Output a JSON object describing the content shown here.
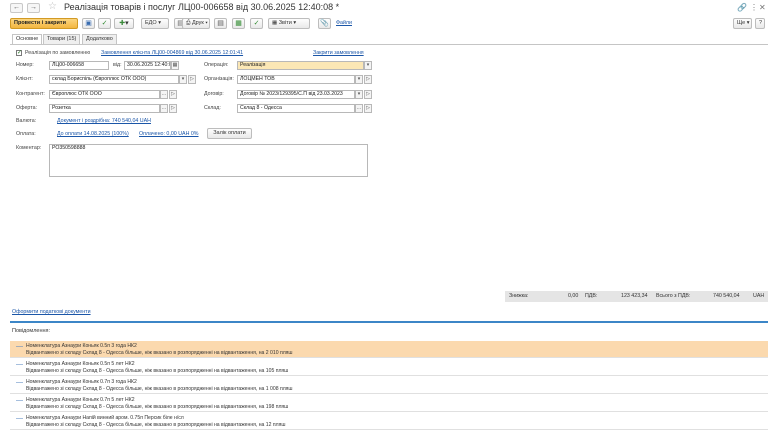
{
  "window": {
    "title": "Реалізація товарів і послуг ЛЦ00-006658 від 30.06.2025 12:40:08 *"
  },
  "toolbar": {
    "post_close": "Провести і закрити",
    "edo": "ЕДО",
    "print": "Друк",
    "reports": "Звіти",
    "files": "Файли",
    "more": "Ще",
    "help": "?"
  },
  "tabs": [
    {
      "label": "Основне",
      "active": true
    },
    {
      "label": "Товари (15)",
      "active": false
    },
    {
      "label": "Додатково",
      "active": false
    }
  ],
  "header": {
    "by_order_label": "Реалізація по замовленню",
    "order_link": "Замовлення клієнта ЛЦ00-004869 від 30.06.2025 12:01:41",
    "close_orders_link": "Закрити замовлення"
  },
  "form": {
    "number_label": "Номер:",
    "number_value": "ЛЦ00-006658",
    "date_label": "від:",
    "date_value": "30.06.2025 12:40:08",
    "operation_label": "Операція:",
    "operation_value": "Реалізація",
    "client_label": "Клієнт:",
    "client_value": "склад Бориспіль (Європлюс ОТК ООО)",
    "organization_label": "Організація:",
    "organization_value": "ЛОЦМЕН ТОВ",
    "counterparty_label": "Контрагент:",
    "counterparty_value": "Європлюс ОТК ООО",
    "contract_label": "Договір:",
    "contract_value": "Договір № 2023/129395/С.П від 23.03.2023",
    "offer_label": "Оферта:",
    "offer_value": "Розетка",
    "warehouse_label": "Склад:",
    "warehouse_value": "Склад 8 - Одесса",
    "currency_label": "Валюта:",
    "currency_link": "Документ і роздрібна:  740 540,04  UAH",
    "payment_label": "Оплата:",
    "payment_due_link": "До оплати 14.08.2025 (100%)",
    "paid_link": "Оплачено: 0,00 UAH 0%",
    "payment_button": "Залік оплати",
    "comment_label": "Коментар:",
    "comment_value": "РО350598888"
  },
  "totals": {
    "discount_label": "Знижка:",
    "discount_value": "0,00",
    "vat_label": "ПДВ:",
    "vat_value": "123 423,34",
    "total_label": "Всього з ПДВ:",
    "total_value": "740 540,04",
    "currency": "UAH"
  },
  "tax_link": "Оформити податкові документи",
  "messages_title": "Повідомлення:",
  "messages": [
    {
      "line1": "Номенклатура Азнаури Коньяк 0.5п 3 года НК2",
      "line2": "Відвантажено зі складу Склад 8 - Одесса більше, ніж вказано в розпорядженні на відвантаження, на 2 010 пляш",
      "highlight": true
    },
    {
      "line1": "Номенклатура Азнаури Коньяк 0.5п 5 лет НК2",
      "line2": "Відвантажено зі складу Склад 8 - Одесса більше, ніж вказано в розпорядженні на відвантаження, на 105 пляш",
      "highlight": false
    },
    {
      "line1": "Номенклатура Азнаури Коньяк 0.7п 3 года НК2",
      "line2": "Відвантажено зі складу Склад 8 - Одесса більше, ніж вказано в розпорядженні на відвантаження, на 1 008 пляш",
      "highlight": false
    },
    {
      "line1": "Номенклатура Азнаури Коньяк 0.7п 5 лет НК2",
      "line2": "Відвантажено зі складу Склад 8 - Одесса більше, ніж вказано в розпорядженні на відвантаження, на 198 пляш",
      "highlight": false
    },
    {
      "line1": "Номенклатура Азнаури Напій винний аром. 0.75п Персик біле н/сл",
      "line2": "Відвантажено зі складу Склад 8 - Одесса більше, ніж вказано в розпорядженні на відвантаження, на 12 пляш",
      "highlight": false
    }
  ],
  "colors": {
    "primary_button": "#f3b640",
    "link": "#1b56a8",
    "highlight_row": "#fbd9ae",
    "separator": "#3c86c7"
  }
}
